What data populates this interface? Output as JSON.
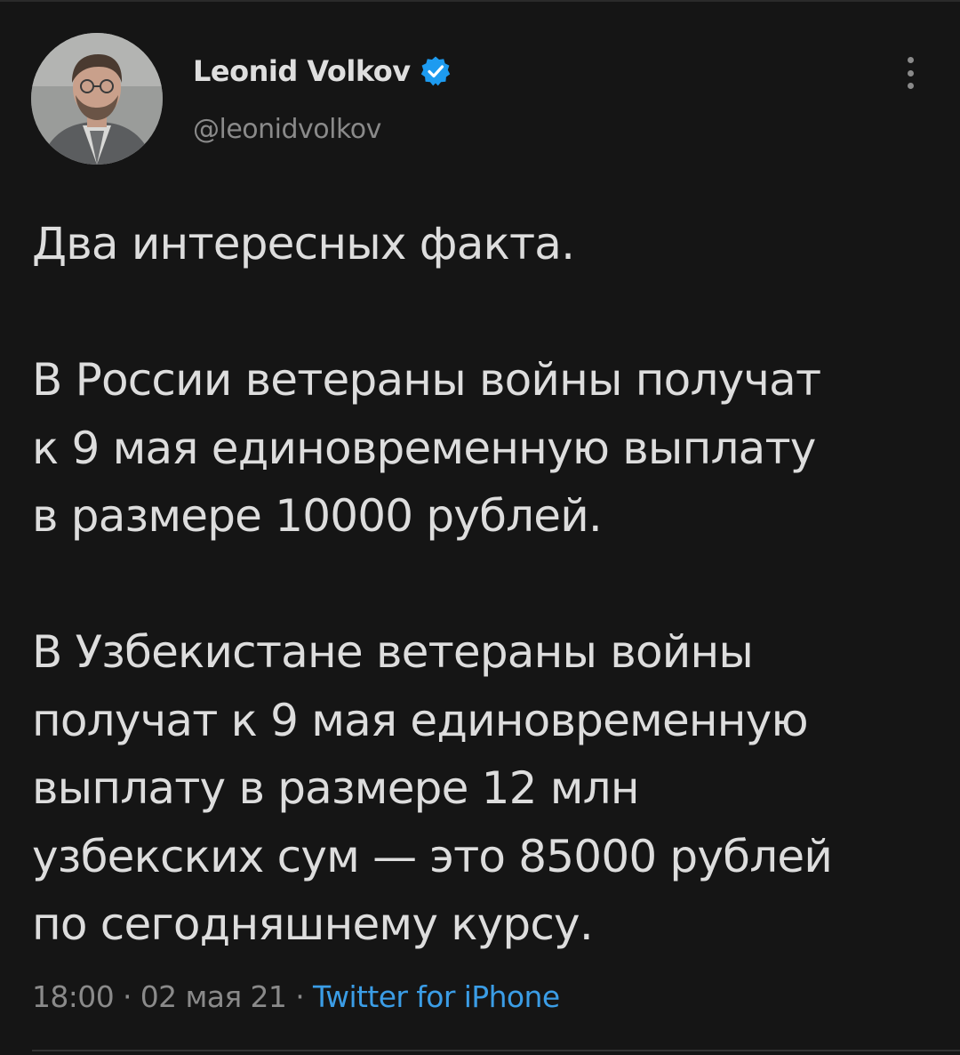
{
  "author": {
    "display_name": "Leonid Volkov",
    "handle": "@leonidvolkov",
    "verified_icon": "verified-badge-icon",
    "avatar_icon": "profile-photo"
  },
  "tweet": {
    "lines_p1": [
      "Два интересных факта."
    ],
    "lines_p2": [
      "В России ветераны войны получат",
      "к 9 мая единовременную выплату",
      "в размере 10000 рублей."
    ],
    "lines_p3": [
      "В Узбекистане ветераны войны",
      "получат к 9 мая единовременную",
      "выплату в размере 12 млн",
      "узбекских сум — это 85000 рублей",
      "по сегодняшнему курсу."
    ]
  },
  "meta": {
    "time": "18:00",
    "separator": " · ",
    "date": "02 мая 21",
    "source": "Twitter for iPhone"
  },
  "colors": {
    "background": "#151515",
    "text": "#dddddd",
    "secondary": "#8a8a8a",
    "link": "#3b9de6",
    "verified": "#1d9bf0"
  }
}
